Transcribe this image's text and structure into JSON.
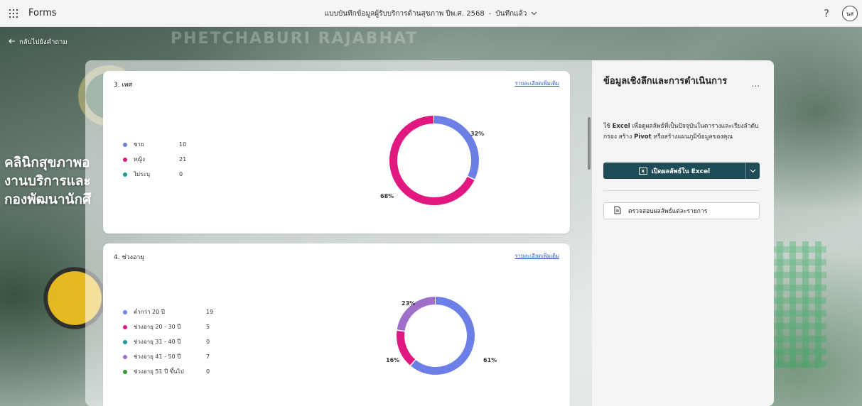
{
  "topbar": {
    "app_name": "Forms",
    "doc_title": "แบบบันทึกข้อมูลผู้รับบริการด้านสุขภาพ ปีพ.ศ. 2568",
    "separator": "-",
    "save_status": "บันทึกแล้ว",
    "avatar_initials": "นส"
  },
  "back_label": "กลับไปยังคำถาม",
  "background": {
    "brand": "PHETCHABURI RAJABHAT",
    "line1": "คลินิกสุขภาพอ",
    "line2": "งานบริการและ",
    "line3": "กองพัฒนานักศึ"
  },
  "cards": [
    {
      "title": "3. เพศ",
      "more_link": "รายละเอียดเพิ่มเติม",
      "legend": [
        {
          "label": "ชาย",
          "count": "10",
          "color": "#6b7fe6"
        },
        {
          "label": "หญิง",
          "count": "21",
          "color": "#e0187f"
        },
        {
          "label": "ไม่ระบุ",
          "count": "0",
          "color": "#1a9ba1"
        }
      ],
      "donut_values": [
        10,
        21,
        0
      ],
      "labels": {
        "a": "32%",
        "b": "68%"
      }
    },
    {
      "title": "4. ช่วงอายุ",
      "more_link": "รายละเอียดเพิ่มเติม",
      "legend": [
        {
          "label": "ต่ำกว่า 20 ปี",
          "count": "19",
          "color": "#6b7fe6"
        },
        {
          "label": "ช่วงอายุ 20 - 30 ปี",
          "count": "5",
          "color": "#e0187f"
        },
        {
          "label": "ช่วงอายุ 31 - 40 ปี",
          "count": "0",
          "color": "#1a9ba1"
        },
        {
          "label": "ช่วงอายุ 41 - 50 ปี",
          "count": "7",
          "color": "#9f6fc9"
        },
        {
          "label": "ช่วงอายุ 51 ปี ขึ้นไป",
          "count": "0",
          "color": "#2e9c2e"
        }
      ],
      "donut_values": [
        19,
        5,
        0,
        7,
        0
      ],
      "labels": {
        "a": "61%",
        "b": "16%",
        "c": "23%"
      }
    }
  ],
  "side": {
    "title": "ข้อมูลเชิงลึกและการดำเนินการ",
    "more": "...",
    "desc_1": "ใช้ ",
    "desc_excel": "Excel",
    "desc_2": " เพื่อดูผลลัพธ์ที่เป็นปัจจุบันในตารางและเรียงลำดับ กรอง สร้าง ",
    "desc_pivot": "Pivot",
    "desc_3": " หรือสร้างแผนภูมิข้อมูลของคุณ",
    "excel_button": "เปิดผลลัพธ์ใน Excel",
    "review_button": "ตรวจสอบผลลัพธ์แต่ละรายการ"
  },
  "colors": {
    "excel_btn": "#1f4d57",
    "link": "#2b56c4"
  }
}
